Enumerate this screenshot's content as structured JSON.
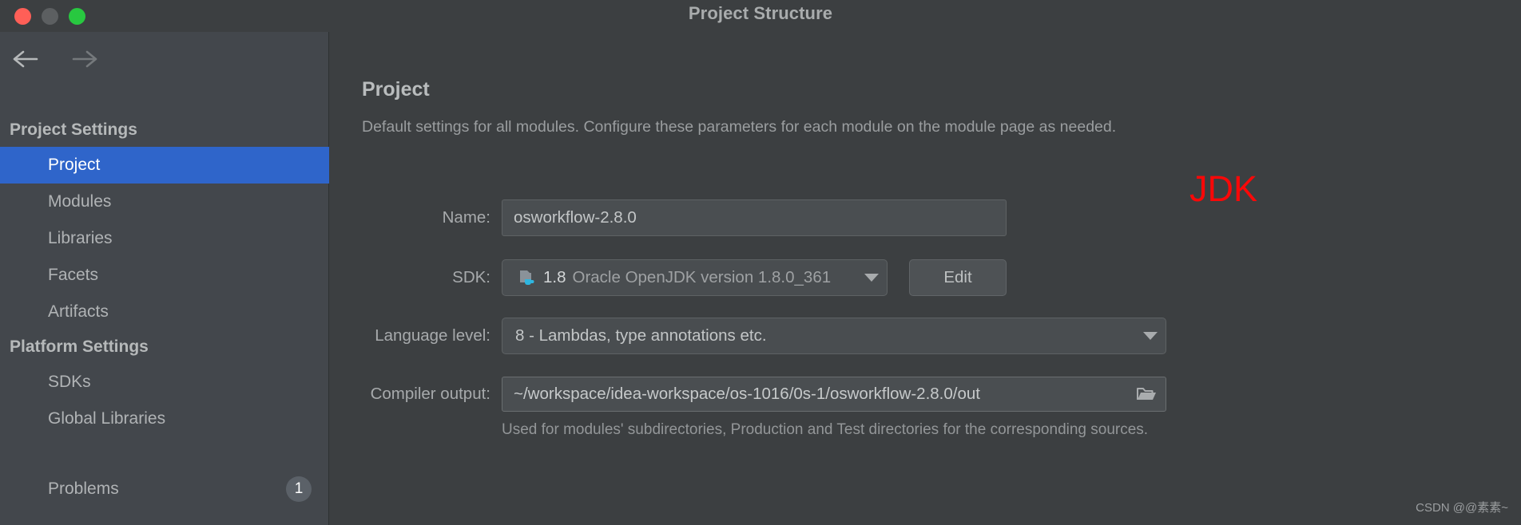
{
  "window": {
    "title": "Project Structure",
    "traffic_lights": [
      "close",
      "minimize",
      "zoom"
    ],
    "colors": {
      "close": "#ff5f57",
      "minimize": "#5c5f61",
      "zoom": "#28c840",
      "accent_selected": "#2f65ca",
      "annotation_red": "#fa0808",
      "sidebar_bg": "#43474c",
      "main_bg": "#3c3f41"
    }
  },
  "sidebar": {
    "nav": {
      "back_icon": "arrow-left-icon",
      "forward_icon": "arrow-right-icon"
    },
    "sections": [
      {
        "header": "Project Settings",
        "items": [
          {
            "label": "Project",
            "selected": true
          },
          {
            "label": "Modules",
            "selected": false
          },
          {
            "label": "Libraries",
            "selected": false
          },
          {
            "label": "Facets",
            "selected": false
          },
          {
            "label": "Artifacts",
            "selected": false
          }
        ]
      },
      {
        "header": "Platform Settings",
        "items": [
          {
            "label": "SDKs",
            "selected": false
          },
          {
            "label": "Global Libraries",
            "selected": false
          }
        ]
      }
    ],
    "problems": {
      "label": "Problems",
      "count": "1"
    }
  },
  "main": {
    "title": "Project",
    "subtitle": "Default settings for all modules. Configure these parameters for each module on the module page as needed.",
    "fields": {
      "name": {
        "label": "Name:",
        "value": "osworkflow-2.8.0"
      },
      "sdk": {
        "label": "SDK:",
        "icon": "java-sdk-folder-icon",
        "version": "1.8",
        "description": "Oracle OpenJDK version 1.8.0_361",
        "caret_icon": "chevron-down-icon",
        "edit_button": "Edit"
      },
      "language_level": {
        "label": "Language level:",
        "value": "8 - Lambdas, type annotations etc.",
        "caret_icon": "chevron-down-icon"
      },
      "compiler_output": {
        "label": "Compiler output:",
        "value": "~/workspace/idea-workspace/os-1016/0s-1/osworkflow-2.8.0/out",
        "browse_icon": "folder-open-icon",
        "hint": "Used for modules' subdirectories, Production and Test directories for the corresponding sources."
      }
    }
  },
  "annotation": {
    "text": "JDK"
  },
  "watermark": {
    "text": "CSDN @@素素~"
  }
}
